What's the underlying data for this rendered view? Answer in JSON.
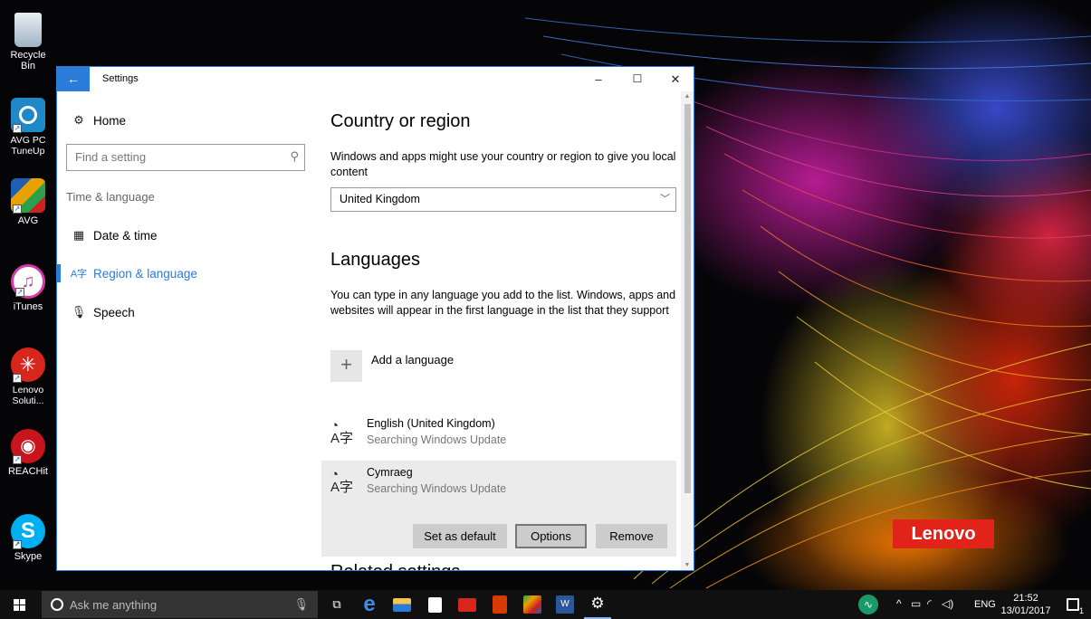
{
  "desktop": {
    "icons": [
      {
        "label": "Recycle Bin",
        "icon": "recycle-bin-icon",
        "color": "#b7c9d6"
      },
      {
        "label": "AVG PC TuneUp",
        "icon": "avg-tuneup-icon",
        "color": "#1e88c8"
      },
      {
        "label": "AVG",
        "icon": "avg-icon",
        "color": "#e8a200"
      },
      {
        "label": "iTunes",
        "icon": "itunes-icon",
        "color": "#d63aa9"
      },
      {
        "label": "Lenovo Soluti...",
        "icon": "lenovo-solutions-icon",
        "color": "#d9261c"
      },
      {
        "label": "REACHit",
        "icon": "reachit-icon",
        "color": "#c8141c"
      },
      {
        "label": "Skype",
        "icon": "skype-icon",
        "color": "#00aff0"
      }
    ],
    "wallpaper_brand": "Lenovo"
  },
  "window": {
    "title": "Settings",
    "accent": "#2b7bd8",
    "controls": {
      "minimize": "–",
      "maximize": "☐",
      "close": "✕"
    }
  },
  "sidebar": {
    "home_label": "Home",
    "search_placeholder": "Find a setting",
    "section_label": "Time & language",
    "items": [
      {
        "label": "Date & time",
        "icon": "calendar-clock-icon",
        "active": false
      },
      {
        "label": "Region & language",
        "icon": "region-language-icon",
        "active": true
      },
      {
        "label": "Speech",
        "icon": "microphone-icon",
        "active": false
      }
    ]
  },
  "content": {
    "country_heading": "Country or region",
    "country_desc": "Windows and apps might use your country or region to give you local content",
    "country_value": "United Kingdom",
    "languages_heading": "Languages",
    "languages_desc": "You can type in any language you add to the list. Windows, apps and websites will appear in the first language in the list that they support",
    "add_language_label": "Add a language",
    "languages": [
      {
        "name": "English (United Kingdom)",
        "status": "Searching Windows Update",
        "selected": false
      },
      {
        "name": "Cymraeg",
        "status": "Searching Windows Update",
        "selected": true
      }
    ],
    "language_buttons": {
      "set_default": "Set as default",
      "options": "Options",
      "remove": "Remove"
    },
    "related_heading": "Related settings"
  },
  "taskbar": {
    "search_placeholder": "Ask me anything",
    "pinned_apps": [
      "task-view-icon",
      "edge-icon",
      "file-explorer-icon",
      "store-icon",
      "mail-icon",
      "office-icon",
      "photos-icon",
      "word-icon",
      "settings-gear-icon"
    ],
    "tray_language": "ENG",
    "time": "21:52",
    "date": "13/01/2017",
    "notification_count": "1"
  }
}
